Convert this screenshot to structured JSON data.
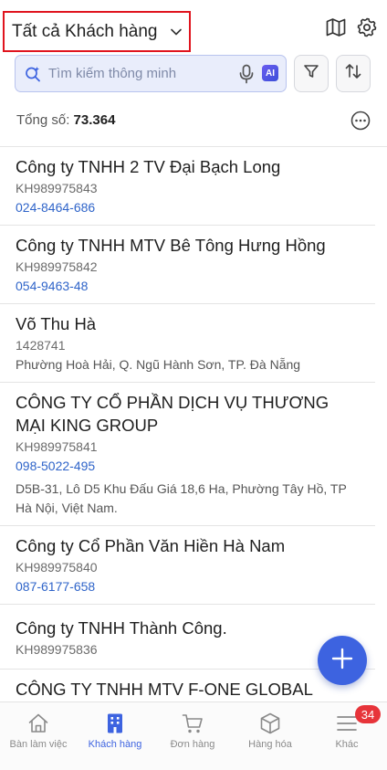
{
  "header": {
    "title": "Tất cả Khách hàng",
    "icons": [
      "chevron-down-icon",
      "map-icon",
      "gear-icon"
    ]
  },
  "search": {
    "placeholder": "Tìm kiếm thông minh",
    "ai_label": "AI",
    "icons": [
      "smart-search-icon",
      "microphone-icon",
      "filter-icon",
      "sort-icon"
    ]
  },
  "summary": {
    "label": "Tổng số:",
    "count": "73.364"
  },
  "customers": [
    {
      "name": "Công ty TNHH 2 TV Đại Bạch Long",
      "code": "KH989975843",
      "phone": "024-8464-686",
      "address": ""
    },
    {
      "name": "Công ty TNHH MTV Bê Tông Hưng Hồng",
      "code": "KH989975842",
      "phone": "054-9463-48",
      "address": ""
    },
    {
      "name": "Võ Thu Hà",
      "code": "1428741",
      "phone": "",
      "address": "Phường Hoà Hải, Q. Ngũ Hành Sơn, TP. Đà Nẵng"
    },
    {
      "name": "CÔNG TY CỔ PHẦN DỊCH VỤ THƯƠNG MẠI KING GROUP",
      "code": "KH989975841",
      "phone": "098-5022-495",
      "address": "D5B-31, Lô D5 Khu Đấu Giá 18,6 Ha, Phường Tây Hồ, TP Hà Nội, Việt Nam."
    },
    {
      "name": "Công ty Cổ Phần Văn Hiền Hà Nam",
      "code": "KH989975840",
      "phone": "087-6177-658",
      "address": ""
    },
    {
      "name": "Công ty TNHH Thành Công.",
      "code": "KH989975836",
      "phone": "",
      "address": ""
    },
    {
      "name": "CÔNG TY TNHH MTV F-ONE GLOBAL FOODS",
      "code": "",
      "phone": "",
      "address": ""
    }
  ],
  "tabs": [
    {
      "label": "Bàn làm việc",
      "icon": "home-icon",
      "active": false
    },
    {
      "label": "Khách hàng",
      "icon": "building-icon",
      "active": true
    },
    {
      "label": "Đơn hàng",
      "icon": "cart-icon",
      "active": false
    },
    {
      "label": "Hàng hóa",
      "icon": "box-icon",
      "active": false
    },
    {
      "label": "Khác",
      "icon": "menu-icon",
      "active": false
    }
  ],
  "more_badge": "34",
  "colors": {
    "accent": "#3d63e0",
    "highlight_border": "#e0141e",
    "badge": "#e7343a",
    "phone": "#2f64c9"
  }
}
